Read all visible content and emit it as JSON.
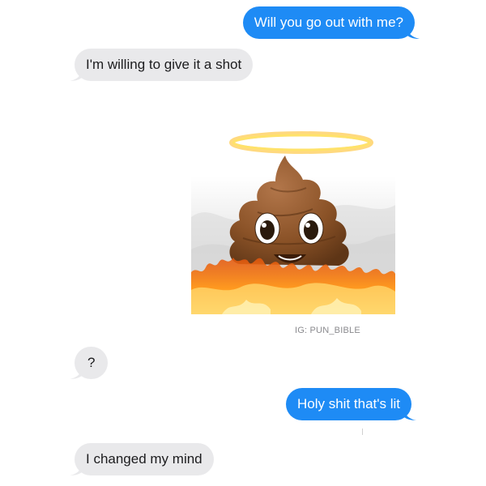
{
  "messages": [
    {
      "direction": "sent",
      "text": "Will you go out with me?"
    },
    {
      "direction": "received",
      "text": "I'm willing to give it a shot"
    },
    {
      "direction": "received",
      "text": "?"
    },
    {
      "direction": "sent",
      "text": "Holy shit that's lit"
    },
    {
      "direction": "received",
      "text": "I changed my mind"
    }
  ],
  "image_message": {
    "icon": "poop-emoji-with-halo-and-flames-icon",
    "watermark": "IG: PUN_BIBLE"
  },
  "colors": {
    "sent_bubble": "#1e8bf5",
    "received_bubble": "#e9e9eb",
    "sent_text": "#ffffff",
    "received_text": "#1c1c1e"
  }
}
